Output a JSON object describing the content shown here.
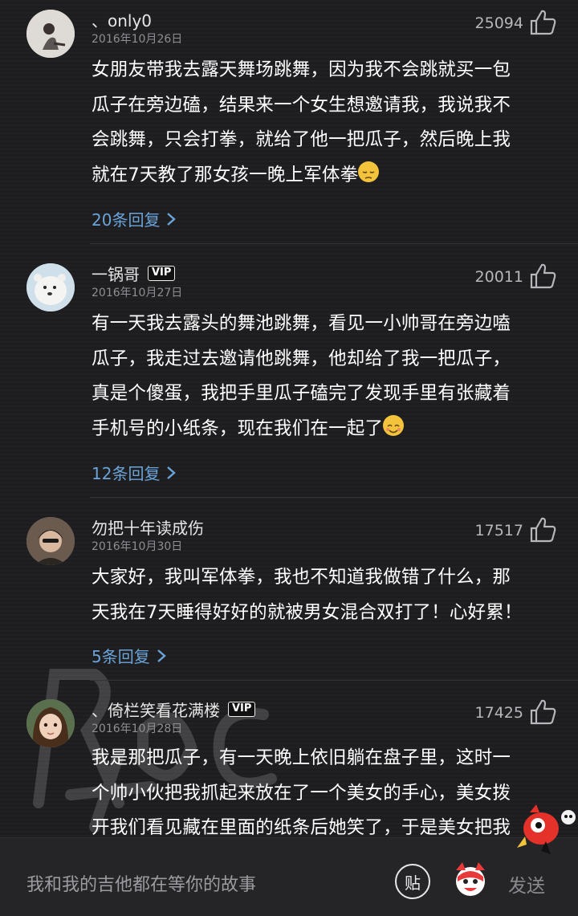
{
  "comments": [
    {
      "username": "、only0",
      "vip": "",
      "date": "2016年10月26日",
      "likes": "25094",
      "body": "女朋友带我去露天舞场跳舞，因为我不会跳就买一包瓜子在旁边磕，结果来一个女生想邀请我，我说我不会跳舞，只会打拳，就给了他一把瓜子，然后晚上我就在7天教了那女孩一晚上军体拳",
      "emoji": "pensive-face",
      "replies": "20条回复"
    },
    {
      "username": "一锅哥",
      "vip": "VIP",
      "date": "2016年10月27日",
      "likes": "20011",
      "body": "有一天我去露头的舞池跳舞，看见一小帅哥在旁边嗑瓜子，我走过去邀请他跳舞，他却给了我一把瓜子，真是个傻蛋，我把手里瓜子磕完了发现手里有张藏着手机号的小纸条，现在我们在一起了",
      "emoji": "smiling-face",
      "replies": "12条回复"
    },
    {
      "username": "勿把十年读成伤",
      "vip": "",
      "date": "2016年10月30日",
      "likes": "17517",
      "body": "大家好，我叫军体拳，我也不知道我做错了什么，那天我在7天睡得好好的就被男女混合双打了！心好累！",
      "emoji": "",
      "replies": "5条回复"
    },
    {
      "username": "、倚栏笑看花满楼",
      "vip": "VIP",
      "date": "2016年10月28日",
      "likes": "17425",
      "body": "我是那把瓜子，有一天晚上依旧躺在盘子里，这时一个帅小伙把我抓起来放在了一个美女的手心，美女拨开我们看见藏在里面的纸条后她笑了，于是美女把我",
      "emoji": "",
      "replies": ""
    }
  ],
  "lines": {
    "c0": [
      "女朋友带我去露天舞场跳舞，因为我不会跳就买一包",
      "瓜子在旁边磕，结果来一个女生想邀请我，我说我不",
      "会跳舞，只会打拳，就给了他一把瓜子，然后晚上我",
      "就在7天教了那女孩一晚上军体拳"
    ],
    "c1": [
      "有一天我去露头的舞池跳舞，看见一小帅哥在旁边嗑",
      "瓜子，我走过去邀请他跳舞，他却给了我一把瓜子，",
      "真是个傻蛋，我把手里瓜子磕完了发现手里有张藏着",
      "手机号的小纸条，现在我们在一起了"
    ],
    "c2": [
      "大家好，我叫军体拳，我也不知道我做错了什么，那",
      "天我在7天睡得好好的就被男女混合双打了！心好累！"
    ],
    "c3": [
      "我是那把瓜子，有一天晚上依旧躺在盘子里，这时一",
      "个帅小伙把我抓起来放在了一个美女的手心，美女拨",
      "开我们看见藏在里面的纸条后她笑了，于是美女把我"
    ]
  },
  "bottom_bar": {
    "placeholder": "我和我的吉他都在等你的故事",
    "paste_label": "贴",
    "send_label": "发送"
  },
  "colors": {
    "background": "#1d1d20",
    "reply_link": "#6aa4d8",
    "text": "#ffffff",
    "meta": "#8e8e93"
  }
}
